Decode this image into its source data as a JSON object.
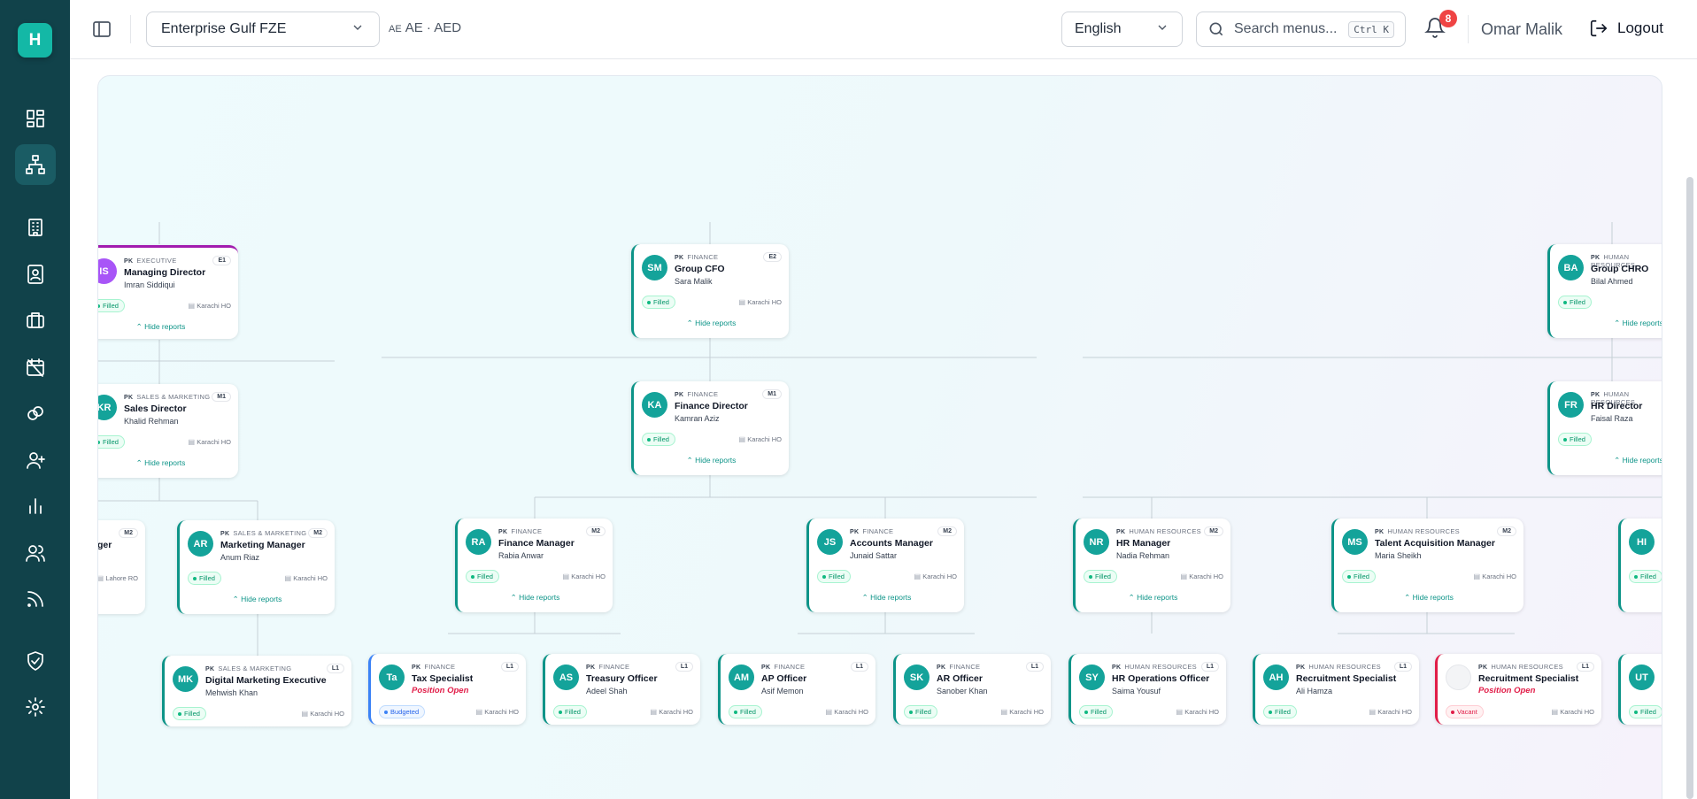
{
  "app": {
    "logo_letter": "H"
  },
  "sidebar": {
    "items": [
      {
        "icon": "dashboard-icon"
      },
      {
        "icon": "org-chart-icon",
        "active": true
      },
      {
        "icon": "building-icon"
      },
      {
        "icon": "contact-card-icon"
      },
      {
        "icon": "briefcase-icon"
      },
      {
        "icon": "calendar-off-icon"
      },
      {
        "icon": "link-icon"
      },
      {
        "icon": "user-plus-icon"
      },
      {
        "icon": "bar-chart-icon"
      },
      {
        "icon": "users-icon"
      },
      {
        "icon": "feed-icon"
      },
      {
        "icon": "shield-check-icon"
      },
      {
        "icon": "settings-icon"
      }
    ]
  },
  "header": {
    "company": "Enterprise Gulf FZE",
    "currency_code": "AE",
    "currency_label": "AE · AED",
    "language": "English",
    "search_placeholder": "Search menus...",
    "search_shortcut": "Ctrl K",
    "notification_count": "8",
    "user_name": "Omar Malik",
    "logout_label": "Logout"
  },
  "org": {
    "hide_label": "⌃ Hide reports",
    "cards": {
      "md": {
        "initials": "IS",
        "country": "PK",
        "dept": "EXECUTIVE",
        "level": "E1",
        "title": "Managing Director",
        "person": "Imran Siddiqui",
        "status": "Filled",
        "location": "Karachi HO"
      },
      "cfo": {
        "initials": "SM",
        "country": "PK",
        "dept": "FINANCE",
        "level": "E2",
        "title": "Group CFO",
        "person": "Sara Malik",
        "status": "Filled",
        "location": "Karachi HO"
      },
      "chro": {
        "initials": "BA",
        "country": "PK",
        "dept": "HUMAN RESOURCES",
        "title": "Group CHRO",
        "person": "Bilal Ahmed",
        "status": "Filled"
      },
      "sd": {
        "initials": "KR",
        "country": "PK",
        "dept": "SALES & MARKETING",
        "level": "M1",
        "title": "Sales Director",
        "person": "Khalid Rehman",
        "status": "Filled",
        "location": "Karachi HO"
      },
      "fd": {
        "initials": "KA",
        "country": "PK",
        "dept": "FINANCE",
        "level": "M1",
        "title": "Finance Director",
        "person": "Kamran Aziz",
        "status": "Filled",
        "location": "Karachi HO"
      },
      "hrd": {
        "initials": "FR",
        "country": "PK",
        "dept": "HUMAN RESOURCES",
        "title": "HR Director",
        "person": "Faisal Raza",
        "status": "Filled"
      },
      "partial": {
        "level": "M2",
        "title": "ger",
        "location": "Lahore RO"
      },
      "mm": {
        "initials": "AR",
        "country": "PK",
        "dept": "SALES & MARKETING",
        "level": "M2",
        "title": "Marketing Manager",
        "person": "Anum Riaz",
        "status": "Filled",
        "location": "Karachi HO"
      },
      "fm": {
        "initials": "RA",
        "country": "PK",
        "dept": "FINANCE",
        "level": "M2",
        "title": "Finance Manager",
        "person": "Rabia Anwar",
        "status": "Filled",
        "location": "Karachi HO"
      },
      "am": {
        "initials": "JS",
        "country": "PK",
        "dept": "FINANCE",
        "level": "M2",
        "title": "Accounts Manager",
        "person": "Junaid Sattar",
        "status": "Filled",
        "location": "Karachi HO"
      },
      "hrm": {
        "initials": "NR",
        "country": "PK",
        "dept": "HUMAN RESOURCES",
        "level": "M2",
        "title": "HR Manager",
        "person": "Nadia Rehman",
        "status": "Filled",
        "location": "Karachi HO"
      },
      "tam": {
        "initials": "MS",
        "country": "PK",
        "dept": "HUMAN RESOURCES",
        "level": "M2",
        "title": "Talent Acquisition Manager",
        "person": "Maria Sheikh",
        "status": "Filled",
        "location": "Karachi HO"
      },
      "hi": {
        "initials": "HI",
        "status": "Filled"
      },
      "dme": {
        "initials": "MK",
        "country": "PK",
        "dept": "SALES & MARKETING",
        "level": "L1",
        "title": "Digital Marketing Executive",
        "person": "Mehwish Khan",
        "status": "Filled",
        "location": "Karachi HO"
      },
      "ts": {
        "initials": "Ta",
        "country": "PK",
        "dept": "FINANCE",
        "level": "L1",
        "title": "Tax Specialist",
        "open": "Position Open",
        "status": "Budgeted",
        "location": "Karachi HO"
      },
      "to": {
        "initials": "AS",
        "country": "PK",
        "dept": "FINANCE",
        "level": "L1",
        "title": "Treasury Officer",
        "person": "Adeel Shah",
        "status": "Filled",
        "location": "Karachi HO"
      },
      "ap": {
        "initials": "AM",
        "country": "PK",
        "dept": "FINANCE",
        "level": "L1",
        "title": "AP Officer",
        "person": "Asif Memon",
        "status": "Filled",
        "location": "Karachi HO"
      },
      "ar": {
        "initials": "SK",
        "country": "PK",
        "dept": "FINANCE",
        "level": "L1",
        "title": "AR Officer",
        "person": "Sanober Khan",
        "status": "Filled",
        "location": "Karachi HO"
      },
      "hro": {
        "initials": "SY",
        "country": "PK",
        "dept": "HUMAN RESOURCES",
        "level": "L1",
        "title": "HR Operations Officer",
        "person": "Saima Yousuf",
        "status": "Filled",
        "location": "Karachi HO"
      },
      "rs1": {
        "initials": "AH",
        "country": "PK",
        "dept": "HUMAN RESOURCES",
        "level": "L1",
        "title": "Recruitment Specialist",
        "person": "Ali Hamza",
        "status": "Filled",
        "location": "Karachi HO"
      },
      "rs2": {
        "country": "PK",
        "dept": "HUMAN RESOURCES",
        "level": "L1",
        "title": "Recruitment Specialist",
        "open": "Position Open",
        "status": "Vacant",
        "location": "Karachi HO"
      },
      "ut": {
        "initials": "UT",
        "status": "Filled"
      }
    }
  }
}
